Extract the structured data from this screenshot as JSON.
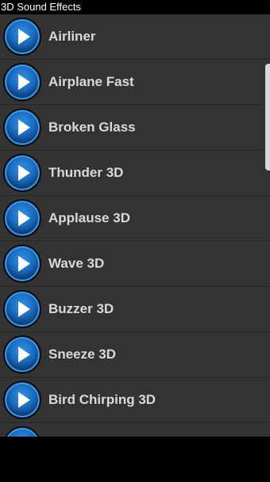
{
  "window": {
    "title": "3D Sound Effects"
  },
  "sounds": [
    {
      "label": "Airliner"
    },
    {
      "label": "Airplane Fast"
    },
    {
      "label": "Broken Glass"
    },
    {
      "label": "Thunder 3D"
    },
    {
      "label": "Applause 3D"
    },
    {
      "label": "Wave 3D"
    },
    {
      "label": "Buzzer 3D"
    },
    {
      "label": "Sneeze 3D"
    },
    {
      "label": "Bird Chirping 3D"
    },
    {
      "label": ""
    }
  ],
  "icons": {
    "play": "play-icon"
  },
  "colors": {
    "list_bg": "#333333",
    "button_blue": "#1b6cc2",
    "label_text": "#d9d9d9"
  }
}
